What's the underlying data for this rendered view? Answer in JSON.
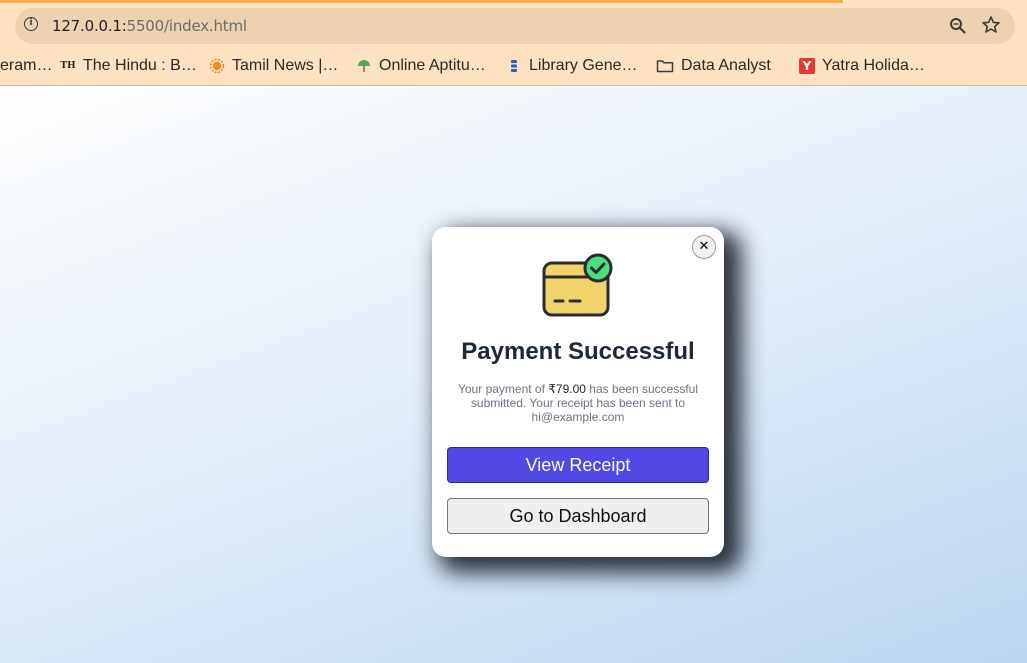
{
  "browser": {
    "url_host": "127.0.0.1:",
    "url_rest": "5500/index.html",
    "bookmarks": [
      {
        "label": "eram…",
        "icon": "none"
      },
      {
        "label": "The Hindu : B…",
        "icon": "th-logo-icon",
        "icon_text": "TH"
      },
      {
        "label": "Tamil News |…",
        "icon": "sun-logo-icon"
      },
      {
        "label": "Online Aptitu…",
        "icon": "umbrella-icon"
      },
      {
        "label": "Library Gene…",
        "icon": "library-icon"
      },
      {
        "label": "Data Analyst",
        "icon": "folder-icon"
      },
      {
        "label": "Yatra Holida…",
        "icon": "yatra-logo-icon",
        "icon_text": "Y"
      }
    ]
  },
  "modal": {
    "title": "Payment Successful",
    "message_pre": "Your payment of ",
    "amount": "₹79.00",
    "message_post": " has been successful submitted. Your receipt has been sent to hi@example.com",
    "close_label": "✕",
    "primary_label": "View Receipt",
    "secondary_label": "Go to Dashboard"
  },
  "colors": {
    "accent": "#5248e5",
    "card": "#f2d36b",
    "check": "#4ade80"
  }
}
